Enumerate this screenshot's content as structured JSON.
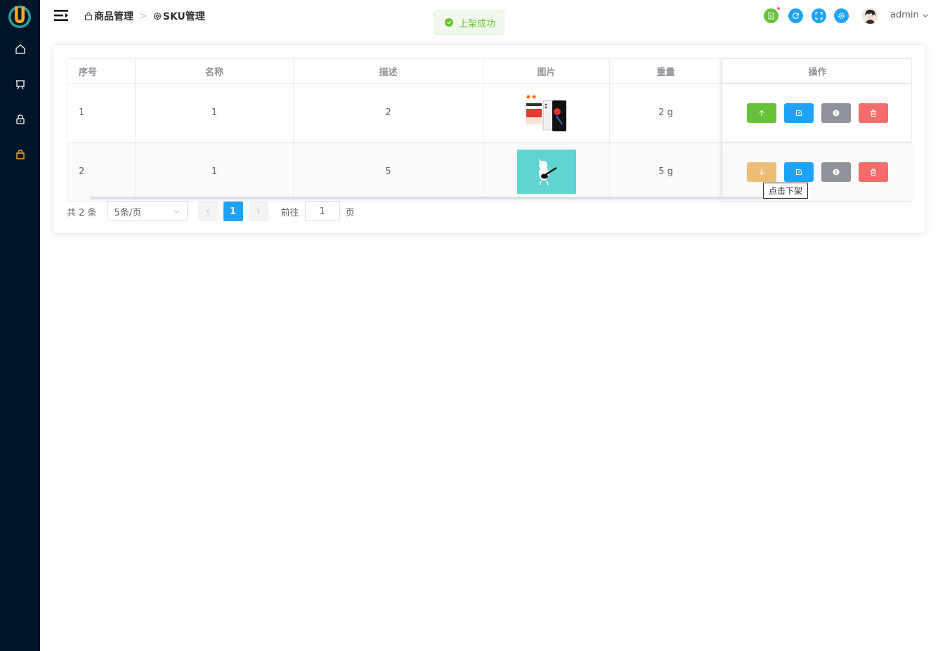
{
  "breadcrumb": [
    {
      "icon": "bag-icon",
      "label": "商品管理"
    },
    {
      "icon": "gear-icon",
      "label": "SKU管理"
    }
  ],
  "toast": {
    "text": "上架成功",
    "type": "success"
  },
  "header": {
    "user": "admin"
  },
  "table": {
    "columns": [
      "序号",
      "名称",
      "描述",
      "图片",
      "重量",
      "操作"
    ],
    "rows": [
      {
        "index": "1",
        "name": "1",
        "desc": "2",
        "image": "phone-product-image",
        "weight": "2 g",
        "sale_state": "on-shelf"
      },
      {
        "index": "2",
        "name": "1",
        "desc": "5",
        "image": "cartoon-figure-image",
        "weight": "5 g",
        "sale_state": "off-shelf"
      }
    ]
  },
  "tooltip": "点击下架",
  "pagination": {
    "total": "共 2 条",
    "page_size": "5条/页",
    "current": "1",
    "goto_label": "前往",
    "goto_value": "1",
    "page_suffix": "页"
  },
  "colors": {
    "sidebar": "#001529",
    "primary": "#1fa3f8",
    "success": "#67c23a",
    "danger": "#f56c6c",
    "warning": "#eebe77",
    "info": "#909399"
  }
}
